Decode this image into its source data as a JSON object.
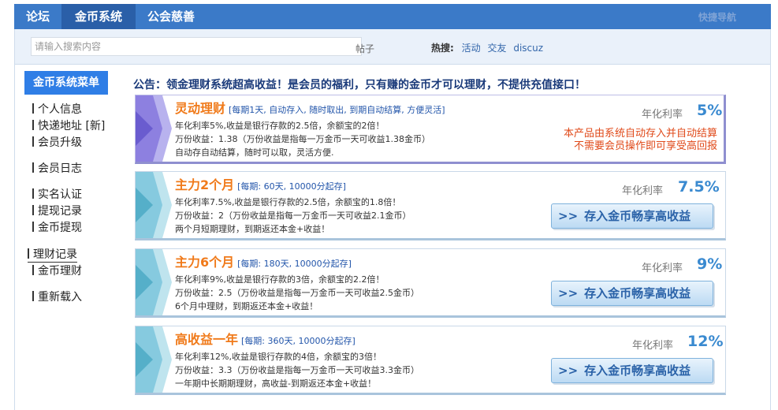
{
  "topnav": {
    "tabs": [
      {
        "label": "论坛",
        "active": false
      },
      {
        "label": "金币系统",
        "active": true
      },
      {
        "label": "公会慈善",
        "active": false
      }
    ],
    "quick_nav": "快捷导航"
  },
  "search": {
    "placeholder": "请输入搜索内容",
    "type": "帖子",
    "hot_label": "热搜:",
    "hot_links": [
      "活动",
      "交友",
      "discuz"
    ]
  },
  "sidebar": {
    "title": "金币系统菜单",
    "items": [
      "个人信息",
      "快递地址 [新]",
      "会员升级",
      "会员日志",
      "实名认证",
      "提现记录",
      "金币提现",
      "理财记录",
      "金币理财",
      "重新载入"
    ]
  },
  "notice": "公告：领金理财系统超高收益！是会员的福利，只有赚的金币才可以理财，不提供充值接口！",
  "products": [
    {
      "name": "灵动理财",
      "period": "[每期1天, 自动存入, 随时取出, 到期自动结算, 方便灵活]",
      "lines": [
        "年化利率5%,收益是银行存款的2.5倍，余额宝的2倍！",
        "万份收益：1.38（万份收益是指每一万金币一天可收益1.38金币）",
        "自动存自动结算，随时可以取，灵活方便."
      ],
      "rate_label": "年化利率",
      "rate": "5%",
      "auto_note_1": "本产品由系统自动存入并自动结算",
      "auto_note_2": "不需要会员操作即可享受高回报"
    },
    {
      "name": "主力2个月",
      "period": "[每期: 60天, 10000分起存]",
      "lines": [
        "年化利率7.5%,收益是银行存款的2.5倍，余额宝的1.8倍！",
        "万份收益：2（万份收益是指每一万金币一天可收益2.1金币）",
        "两个月短期理财，到期返还本金+收益！"
      ],
      "rate_label": "年化利率",
      "rate": "7.5%",
      "button": "存入金币畅享高收益"
    },
    {
      "name": "主力6个月",
      "period": "[每期: 180天, 10000分起存]",
      "lines": [
        "年化利率9%,收益是银行存款的3倍，余额宝的2.2倍！",
        "万份收益：2.5（万份收益是指每一万金币一天可收益2.5金币）",
        "6个月中理财，到期返还本金+收益！"
      ],
      "rate_label": "年化利率",
      "rate": "9%",
      "button": "存入金币畅享高收益"
    },
    {
      "name": "高收益一年",
      "period": "[每期: 360天, 10000分起存]",
      "lines": [
        "年化利率12%,收益是银行存款的4倍，余额宝的3倍！",
        "万份收益：3.3（万份收益是指每一万金币一天可收益3.3金币）",
        "一年期中长期期理财，高收益-到期返还本金+收益！"
      ],
      "rate_label": "年化利率",
      "rate": "12%",
      "button": "存入金币畅享高收益"
    }
  ],
  "colors": {
    "nav_bg": "#3b7ac8",
    "nav_active": "#2a5fa8",
    "menu_title": "#2f7ee6",
    "title_orange": "#f07a1a",
    "rate_blue": "#3a8ad0",
    "note_red": "#e04a1a",
    "gem_purple": "#7e6fd8",
    "gem_teal": "#5fb8d0"
  }
}
